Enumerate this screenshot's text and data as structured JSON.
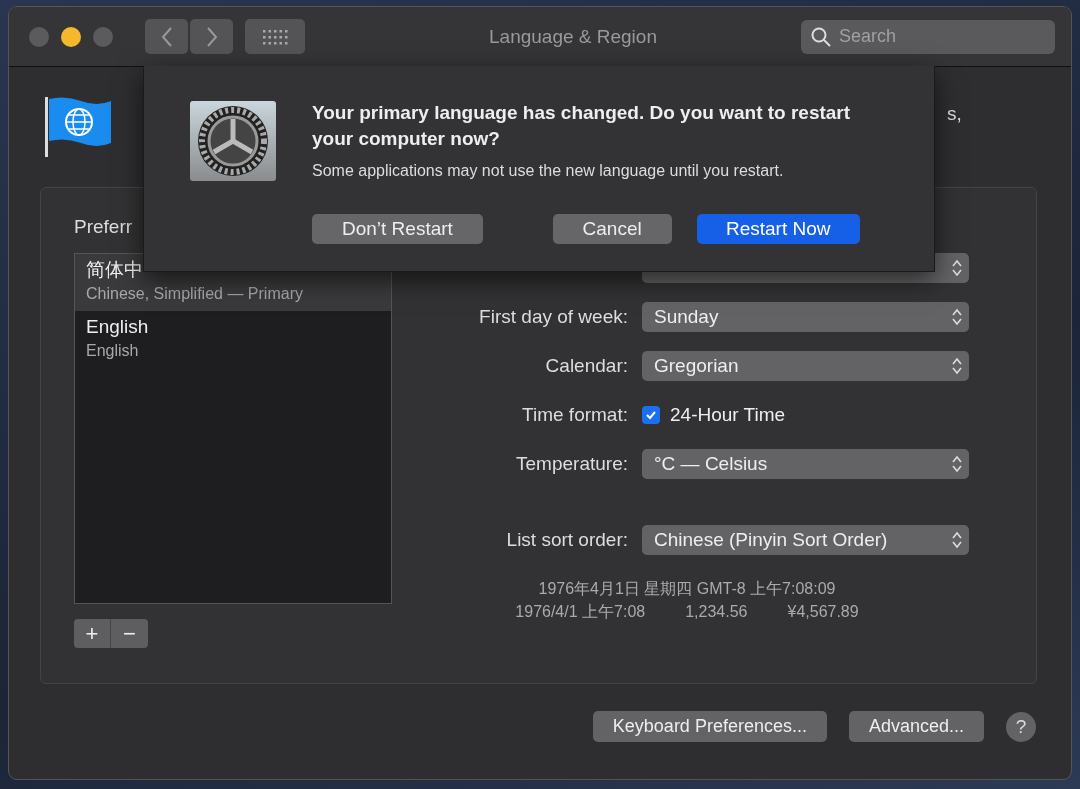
{
  "window": {
    "title": "Language & Region"
  },
  "search": {
    "placeholder": "Search"
  },
  "header": {
    "text_fragment": "s,"
  },
  "preferred_languages": {
    "label": "Preferr",
    "items": [
      {
        "name": "简体中",
        "detail": "Chinese, Simplified — Primary",
        "selected": true
      },
      {
        "name": "English",
        "detail": "English",
        "selected": false
      }
    ],
    "add": "+",
    "remove": "−"
  },
  "settings": [
    {
      "kind": "popup"
    },
    {
      "kind": "popup",
      "label": "First day of week:",
      "value": "Sunday"
    },
    {
      "kind": "popup",
      "label": "Calendar:",
      "value": "Gregorian"
    },
    {
      "kind": "checkbox",
      "label": "Time format:",
      "value": "24-Hour Time",
      "checked": true
    },
    {
      "kind": "popup",
      "label": "Temperature:",
      "value": "°C — Celsius"
    },
    {
      "kind": "popup",
      "label": "List sort order:",
      "value": "Chinese (Pinyin Sort Order)"
    }
  ],
  "samples": [
    "1976年4月1日 星期四 GMT-8 上午7:08:09",
    "1976/4/1 上午7:08",
    "1,234.56",
    "¥4,567.89"
  ],
  "footer_buttons": [
    "Keyboard Preferences...",
    "Advanced..."
  ],
  "help": "?",
  "dialog": {
    "title": "Your primary language has changed. Do you want to restart your computer now?",
    "message": "Some applications may not use the new language until you restart.",
    "buttons": [
      {
        "label": "Don’t Restart",
        "kind": "normal"
      },
      {
        "label": "Cancel",
        "kind": "normal"
      },
      {
        "label": "Restart Now",
        "kind": "default"
      }
    ]
  }
}
